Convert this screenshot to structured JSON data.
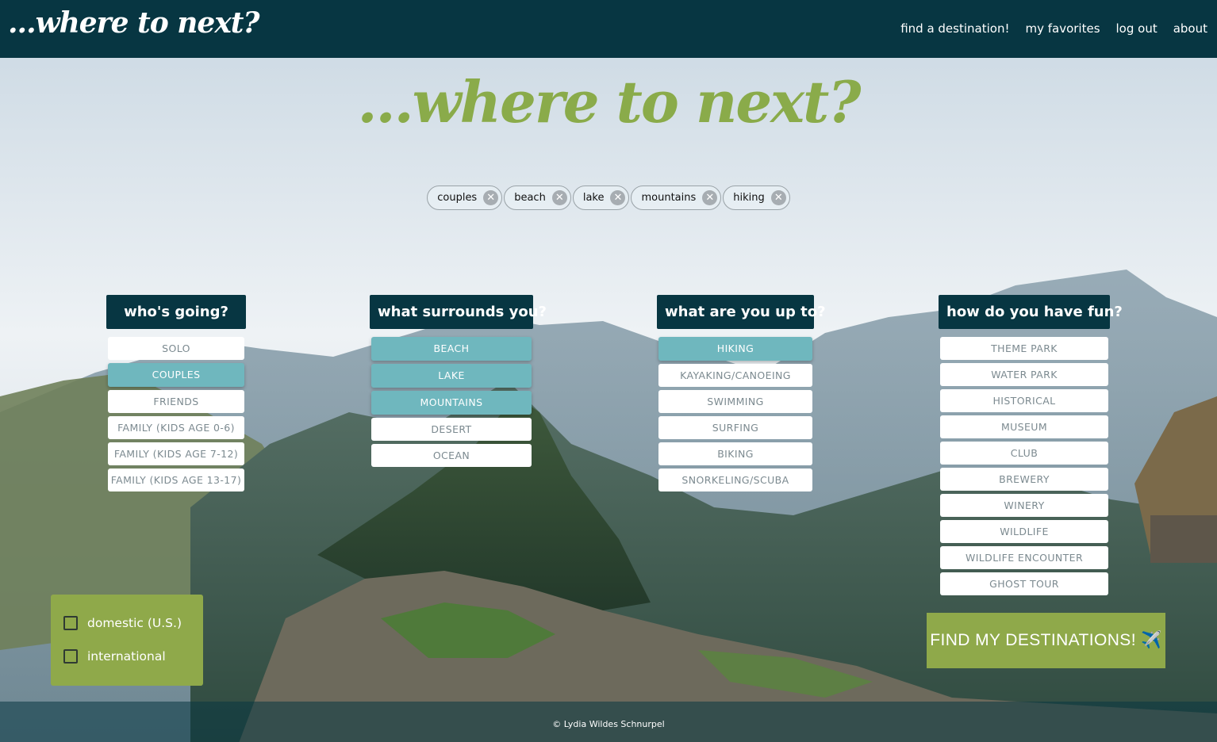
{
  "nav": {
    "logo": "...where to next?",
    "links": [
      "find a destination!",
      "my favorites",
      "log out",
      "about"
    ]
  },
  "hero": {
    "title": "...where to next?"
  },
  "chips": [
    "couples",
    "beach",
    "lake",
    "mountains",
    "hiking"
  ],
  "columns": [
    {
      "heading": "who's going?",
      "options": [
        {
          "label": "SOLO",
          "selected": false
        },
        {
          "label": "COUPLES",
          "selected": true
        },
        {
          "label": "FRIENDS",
          "selected": false
        },
        {
          "label": "FAMILY (KIDS AGE 0-6)",
          "selected": false
        },
        {
          "label": "FAMILY (KIDS AGE 7-12)",
          "selected": false
        },
        {
          "label": "FAMILY (KIDS AGE 13-17)",
          "selected": false
        }
      ]
    },
    {
      "heading": "what surrounds you?",
      "options": [
        {
          "label": "BEACH",
          "selected": true
        },
        {
          "label": "LAKE",
          "selected": true
        },
        {
          "label": "MOUNTAINS",
          "selected": true
        },
        {
          "label": "DESERT",
          "selected": false
        },
        {
          "label": "OCEAN",
          "selected": false
        }
      ]
    },
    {
      "heading": "what are you up to?",
      "options": [
        {
          "label": "HIKING",
          "selected": true
        },
        {
          "label": "KAYAKING/CANOEING",
          "selected": false
        },
        {
          "label": "SWIMMING",
          "selected": false
        },
        {
          "label": "SURFING",
          "selected": false
        },
        {
          "label": "BIKING",
          "selected": false
        },
        {
          "label": "SNORKELING/SCUBA",
          "selected": false
        }
      ]
    },
    {
      "heading": "how do you have fun?",
      "options": [
        {
          "label": "THEME PARK",
          "selected": false
        },
        {
          "label": "WATER PARK",
          "selected": false
        },
        {
          "label": "HISTORICAL",
          "selected": false
        },
        {
          "label": "MUSEUM",
          "selected": false
        },
        {
          "label": "CLUB",
          "selected": false
        },
        {
          "label": "BREWERY",
          "selected": false
        },
        {
          "label": "WINERY",
          "selected": false
        },
        {
          "label": "WILDLIFE",
          "selected": false
        },
        {
          "label": "WILDLIFE ENCOUNTER",
          "selected": false
        },
        {
          "label": "GHOST TOUR",
          "selected": false
        }
      ]
    }
  ],
  "scope": {
    "domestic_label": "domestic (U.S.)",
    "international_label": "international",
    "domestic_checked": false,
    "international_checked": false
  },
  "find_button": {
    "label": "FIND MY DESTINATIONS! ✈️"
  },
  "footer": {
    "text": "© Lydia Wildes Schnurpel"
  },
  "colors": {
    "nav": "#073642",
    "accent_green": "#8fa94a",
    "selected_teal": "#6fb7be",
    "title_green": "#8aab4a"
  }
}
